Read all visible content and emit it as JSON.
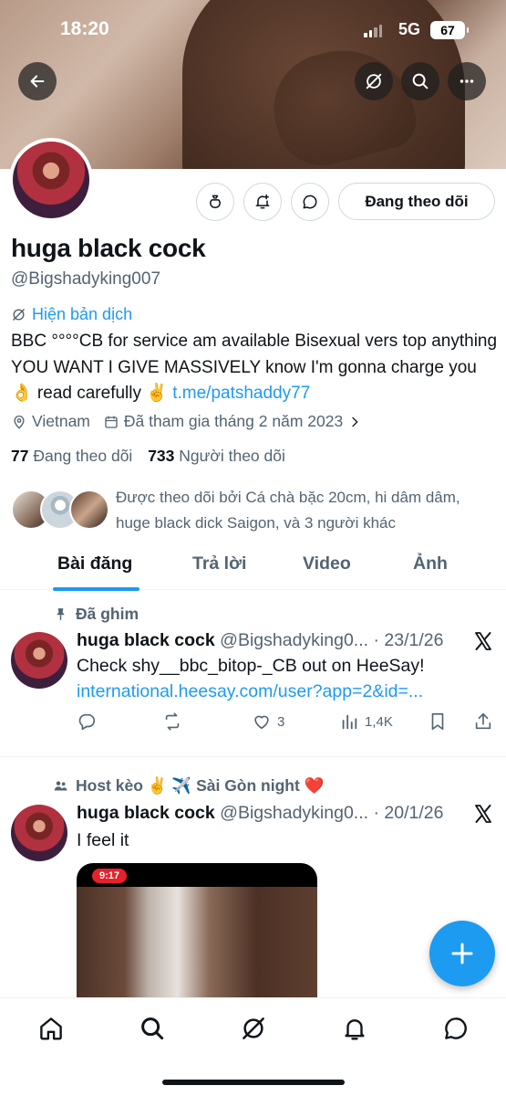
{
  "status_bar": {
    "time": "18:20",
    "network": "5G",
    "battery": "67"
  },
  "profile": {
    "name": "huga black cock",
    "handle": "@Bigshadyking007",
    "translate_label": "Hiện bản dịch",
    "bio_text": "BBC °°°°CB for service am available Bisexual vers top anything YOU WANT I GIVE MASSIVELY know I'm gonna charge you 👌 read carefully ✌️ ",
    "bio_link": "t.me/patshaddy77",
    "location": "Vietnam",
    "joined": "Đã tham gia tháng 2 năm 2023",
    "following_count": "77",
    "following_label": "Đang theo dõi",
    "followers_count": "733",
    "followers_label": "Người theo dõi",
    "followed_by": "Được theo dõi bởi Cá chà bặc 20cm, hi dâm dâm, huge black dick Saigon, và 3 người khác",
    "follow_button": "Đang theo dõi"
  },
  "tabs": [
    {
      "label": "Bài đăng",
      "active": true
    },
    {
      "label": "Trả lời",
      "active": false
    },
    {
      "label": "Video",
      "active": false
    },
    {
      "label": "Ảnh",
      "active": false
    }
  ],
  "posts": [
    {
      "label": "Đã ghim",
      "author": "huga black cock",
      "handle": "@Bigshadyking0...",
      "date": "· 23/1/26",
      "text": "Check shy__bbc_bitop-_CB out on HeeSay!",
      "link": "international.heesay.com/user?app=2&id=...",
      "likes": "3",
      "views": "1,4K"
    },
    {
      "label": "Host kèo ✌️ ✈️ Sài Gòn night ❤️",
      "author": "huga black cock",
      "handle": "@Bigshadyking0...",
      "date": "· 20/1/26",
      "text": "I feel it",
      "media_time": "9:17"
    }
  ],
  "icons": {
    "back": "arrow-left-icon",
    "grok": "grok-icon",
    "search": "search-icon",
    "more": "more-icon"
  },
  "colors": {
    "accent": "#1d9bf0",
    "secondary_text": "#536471",
    "primary_text": "#0f1419"
  }
}
